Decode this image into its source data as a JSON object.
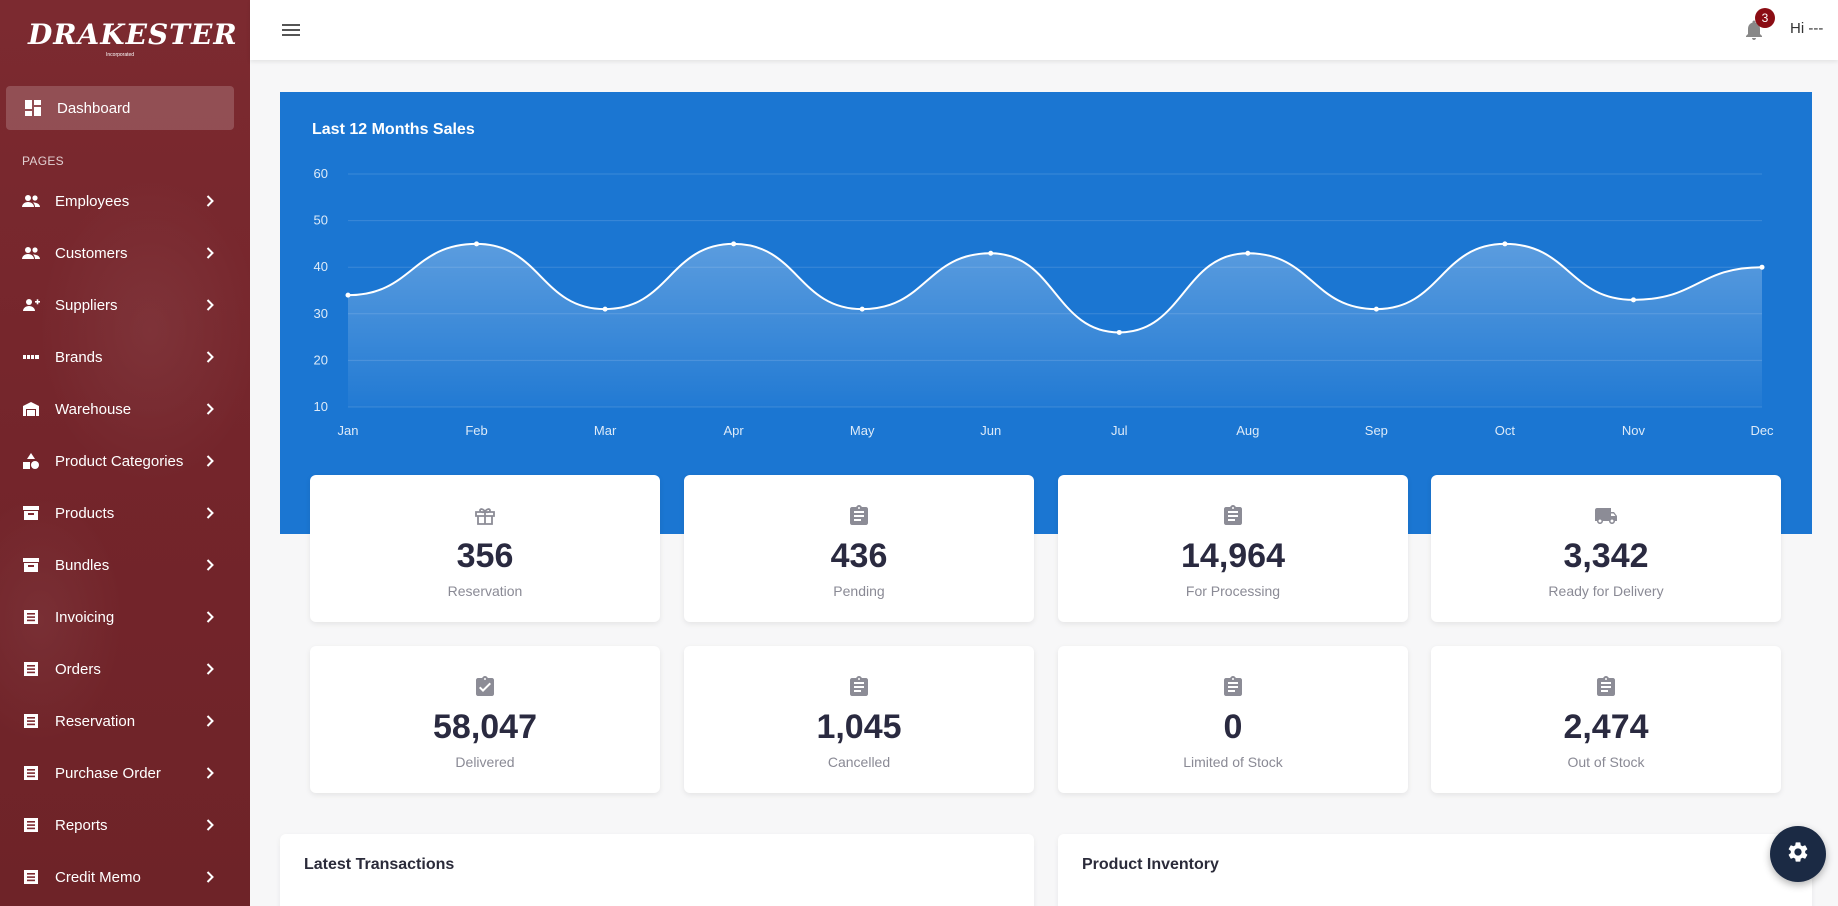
{
  "brand": {
    "logo_text": "DRAKESTER",
    "logo_sub": "Incorporated"
  },
  "sidebar": {
    "active": {
      "label": "Dashboard",
      "icon": "dashboard-icon"
    },
    "section_label": "PAGES",
    "items": [
      {
        "label": "Employees",
        "icon": "people-icon"
      },
      {
        "label": "Customers",
        "icon": "people-icon"
      },
      {
        "label": "Suppliers",
        "icon": "people-plus-icon"
      },
      {
        "label": "Brands",
        "icon": "brand-icon"
      },
      {
        "label": "Warehouse",
        "icon": "warehouse-icon"
      },
      {
        "label": "Product Categories",
        "icon": "category-icon"
      },
      {
        "label": "Products",
        "icon": "box-icon"
      },
      {
        "label": "Bundles",
        "icon": "box-icon"
      },
      {
        "label": "Invoicing",
        "icon": "list-icon"
      },
      {
        "label": "Orders",
        "icon": "list-icon"
      },
      {
        "label": "Reservation",
        "icon": "list-icon"
      },
      {
        "label": "Purchase Order",
        "icon": "list-icon"
      },
      {
        "label": "Reports",
        "icon": "list-icon"
      },
      {
        "label": "Credit  Memo",
        "icon": "list-icon"
      }
    ]
  },
  "topbar": {
    "notification_count": "3",
    "greeting": "Hi ---"
  },
  "colors": {
    "sidebar": "#7c2a30",
    "chart_bg": "#1b76d2",
    "badge": "#8b0d14",
    "fab": "#1b2a44"
  },
  "chart_data": {
    "type": "area",
    "title": "Last 12 Months Sales",
    "categories": [
      "Jan",
      "Feb",
      "Mar",
      "Apr",
      "May",
      "Jun",
      "Jul",
      "Aug",
      "Sep",
      "Oct",
      "Nov",
      "Dec"
    ],
    "series": [
      {
        "values": [
          34,
          45,
          31,
          45,
          31,
          43,
          26,
          43,
          31,
          45,
          33,
          40
        ]
      }
    ],
    "yticks": [
      10,
      20,
      30,
      40,
      50,
      60
    ],
    "ylim": [
      10,
      60
    ],
    "grid": true
  },
  "stats": [
    {
      "value": "356",
      "label": "Reservation",
      "icon": "gift-icon"
    },
    {
      "value": "436",
      "label": "Pending",
      "icon": "clipboard-icon"
    },
    {
      "value": "14,964",
      "label": "For Processing",
      "icon": "clipboard-icon"
    },
    {
      "value": "3,342",
      "label": "Ready for Delivery",
      "icon": "truck-icon"
    },
    {
      "value": "58,047",
      "label": "Delivered",
      "icon": "clipboard-check-icon"
    },
    {
      "value": "1,045",
      "label": "Cancelled",
      "icon": "clipboard-icon"
    },
    {
      "value": "0",
      "label": "Limited of Stock",
      "icon": "clipboard-icon"
    },
    {
      "value": "2,474",
      "label": "Out of Stock",
      "icon": "clipboard-icon"
    }
  ],
  "panels": {
    "transactions_title": "Latest Transactions",
    "inventory_title": "Product Inventory"
  }
}
